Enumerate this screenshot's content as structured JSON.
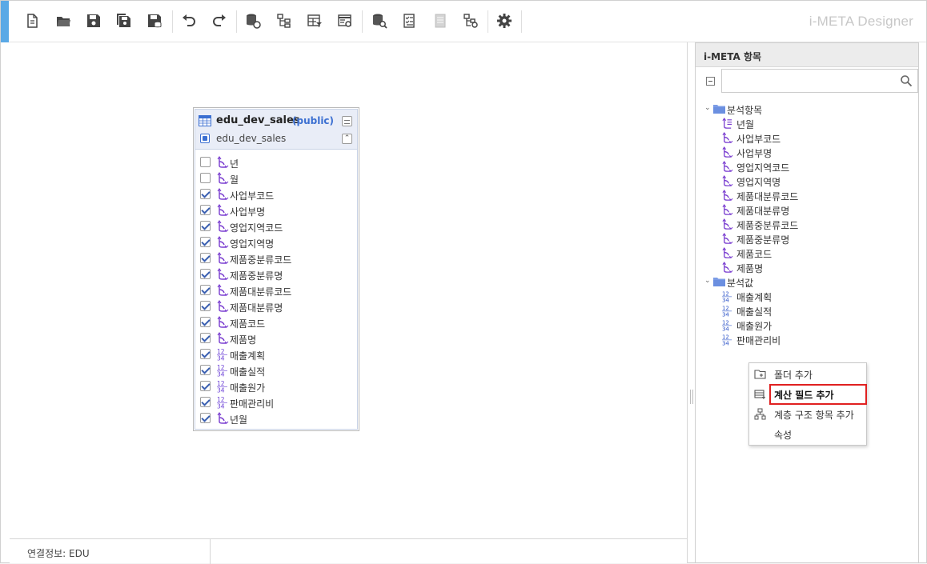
{
  "app": {
    "brand": "i-META Designer",
    "accent_color": "#5aa9e6"
  },
  "toolbar": {
    "buttons": [
      {
        "name": "new-document-icon"
      },
      {
        "name": "open-folder-icon"
      },
      {
        "name": "save-icon"
      },
      {
        "name": "save-all-icon"
      },
      {
        "name": "save-db-icon"
      },
      {
        "name": "undo-icon"
      },
      {
        "name": "redo-icon"
      },
      {
        "name": "database-link-icon"
      },
      {
        "name": "hierarchy-icon"
      },
      {
        "name": "table-filter-icon"
      },
      {
        "name": "table-settings-icon"
      },
      {
        "name": "database-search-icon"
      },
      {
        "name": "checklist-icon"
      },
      {
        "name": "document-disabled-icon"
      },
      {
        "name": "hierarchy-settings-icon"
      },
      {
        "name": "gear-icon"
      }
    ]
  },
  "status": {
    "connection": "연결정보: EDU"
  },
  "table": {
    "name": "edu_dev_sales",
    "schema": "(public)",
    "source": "edu_dev_sales",
    "columns": [
      {
        "label": "년",
        "type": "dimension",
        "checked": false
      },
      {
        "label": "월",
        "type": "dimension",
        "checked": false
      },
      {
        "label": "사업부코드",
        "type": "dimension",
        "checked": true
      },
      {
        "label": "사업부명",
        "type": "dimension",
        "checked": true
      },
      {
        "label": "영업지역코드",
        "type": "dimension",
        "checked": true
      },
      {
        "label": "영업지역명",
        "type": "dimension",
        "checked": true
      },
      {
        "label": "제품중분류코드",
        "type": "dimension",
        "checked": true
      },
      {
        "label": "제품중분류명",
        "type": "dimension",
        "checked": true
      },
      {
        "label": "제품대분류코드",
        "type": "dimension",
        "checked": true
      },
      {
        "label": "제품대분류명",
        "type": "dimension",
        "checked": true
      },
      {
        "label": "제품코드",
        "type": "dimension",
        "checked": true
      },
      {
        "label": "제품명",
        "type": "dimension",
        "checked": true
      },
      {
        "label": "매출계획",
        "type": "measure",
        "checked": true
      },
      {
        "label": "매출실적",
        "type": "measure",
        "checked": true
      },
      {
        "label": "매출원가",
        "type": "measure",
        "checked": true
      },
      {
        "label": "판매관리비",
        "type": "measure",
        "checked": true
      },
      {
        "label": "년월",
        "type": "dimension",
        "checked": true
      }
    ]
  },
  "panel": {
    "title": "i-META 항목",
    "search_placeholder": "",
    "folders": [
      {
        "label": "분석항목",
        "items": [
          {
            "label": "년월",
            "type": "date"
          },
          {
            "label": "사업부코드",
            "type": "dimension"
          },
          {
            "label": "사업부명",
            "type": "dimension"
          },
          {
            "label": "영업지역코드",
            "type": "dimension"
          },
          {
            "label": "영업지역명",
            "type": "dimension"
          },
          {
            "label": "제품대분류코드",
            "type": "dimension"
          },
          {
            "label": "제품대분류명",
            "type": "dimension"
          },
          {
            "label": "제품중분류코드",
            "type": "dimension"
          },
          {
            "label": "제품중분류명",
            "type": "dimension"
          },
          {
            "label": "제품코드",
            "type": "dimension"
          },
          {
            "label": "제품명",
            "type": "dimension"
          }
        ]
      },
      {
        "label": "분석값",
        "items": [
          {
            "label": "매출계획",
            "type": "measure"
          },
          {
            "label": "매출실적",
            "type": "measure"
          },
          {
            "label": "매출원가",
            "type": "measure"
          },
          {
            "label": "판매관리비",
            "type": "measure"
          }
        ]
      }
    ]
  },
  "context_menu": {
    "items": [
      {
        "label": "폴더 추가",
        "icon": "folder-add-icon",
        "highlighted": false
      },
      {
        "label": "계산 필드 추가",
        "icon": "calc-field-icon",
        "highlighted": true
      },
      {
        "label": "계층 구조 항목 추가",
        "icon": "hierarchy-add-icon",
        "highlighted": false
      },
      {
        "label": "속성",
        "icon": "",
        "highlighted": false
      }
    ],
    "highlight_color": "#e02020"
  }
}
